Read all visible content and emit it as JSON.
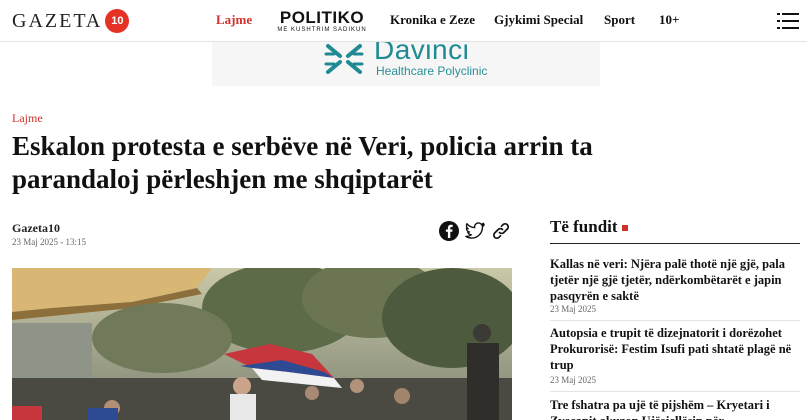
{
  "header": {
    "logo_text": "GAZETA",
    "logo_badge": "10",
    "nav": [
      {
        "label": "Lajme"
      },
      {
        "label": "Kronika e Zeze"
      },
      {
        "label": "Gjykimi Special"
      },
      {
        "label": "Sport"
      },
      {
        "label": "10+"
      }
    ],
    "politiko_main": "POLITIKO",
    "politiko_sub": "ME KUSHTRIM SADIKUN"
  },
  "ad": {
    "title": "Davinci",
    "subtitle": "Healthcare Polyclinic",
    "brand_color": "#1f8a93"
  },
  "article": {
    "category": "Lajme",
    "headline": "Eskalon protesta e serbëve në Veri, policia arrin ta parandaloj përleshjen me shqiptarët",
    "author": "Gazeta10",
    "date": "23 Maj 2025 - 13:15",
    "share_icons": [
      "facebook-icon",
      "twitter-icon",
      "link-icon"
    ]
  },
  "sidebar": {
    "title": "Të fundit",
    "items": [
      {
        "title": "Kallas në veri: Njëra palë thotë një gjë, pala tjetër një gjë tjetër, ndërkombëtarët e japin pasqyrën e saktë",
        "date": "23 Maj 2025"
      },
      {
        "title": "Autopsia e trupit të dizejnatorit i dorëzohet Prokurorisë: Festim Isufi pati shtatë plagë në trup",
        "date": "23 Maj 2025"
      },
      {
        "title": "Tre fshatra pa ujë të pijshëm – Kryetari i Zvecanit akuzon Ujësjellësin për",
        "date": ""
      }
    ]
  },
  "colors": {
    "accent": "#d0312d",
    "text": "#111111"
  }
}
